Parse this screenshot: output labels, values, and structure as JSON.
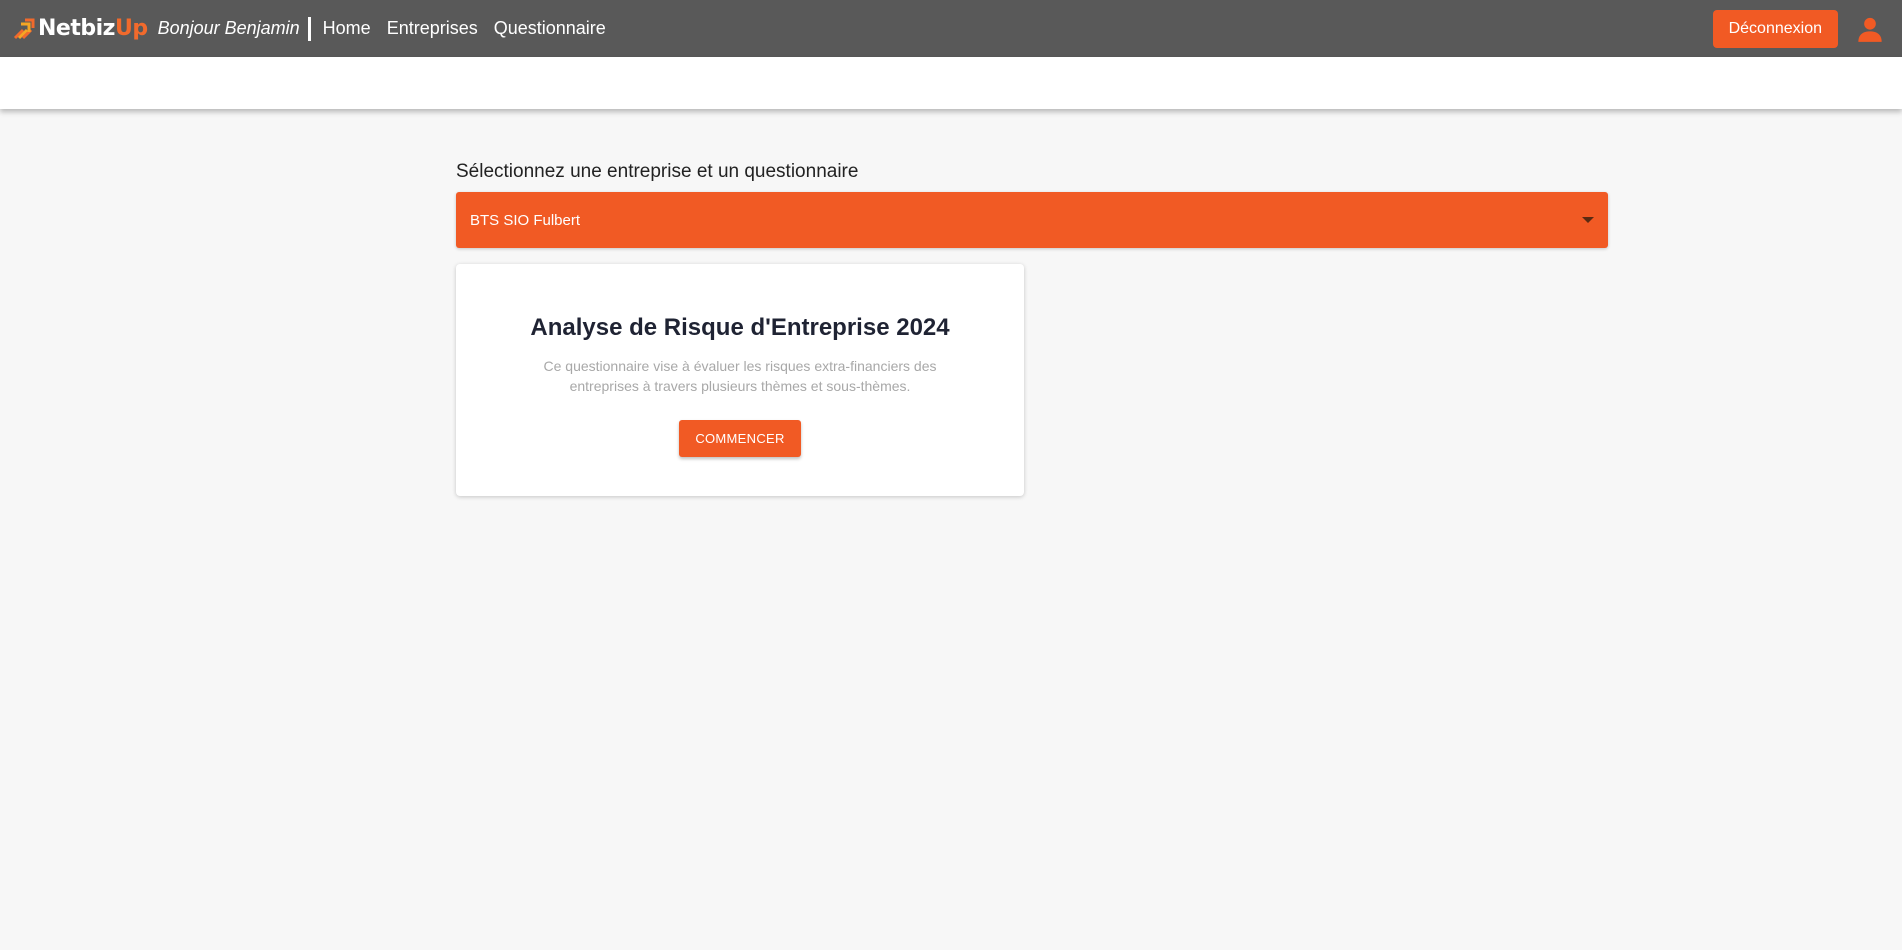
{
  "colors": {
    "topbar_bg": "#595959",
    "accent": "#f15a24",
    "page_bg": "#f7f7f7"
  },
  "header": {
    "brand_main": "Netbiz",
    "brand_accent": "Up",
    "brand_icon": "logo-arrows-icon",
    "greeting": "Bonjour Benjamin",
    "nav": [
      {
        "label": "Home"
      },
      {
        "label": "Entreprises"
      },
      {
        "label": "Questionnaire"
      }
    ],
    "logout_label": "Déconnexion",
    "user_icon": "user-icon"
  },
  "main": {
    "select_label": "Sélectionnez une entreprise et un questionnaire",
    "selected_company": "BTS SIO Fulbert",
    "card": {
      "title": "Analyse de Risque d'Entreprise 2024",
      "description": "Ce questionnaire vise à évaluer les risques extra-financiers des entreprises à travers plusieurs thèmes et sous-thèmes.",
      "button_label": "COMMENCER"
    }
  }
}
